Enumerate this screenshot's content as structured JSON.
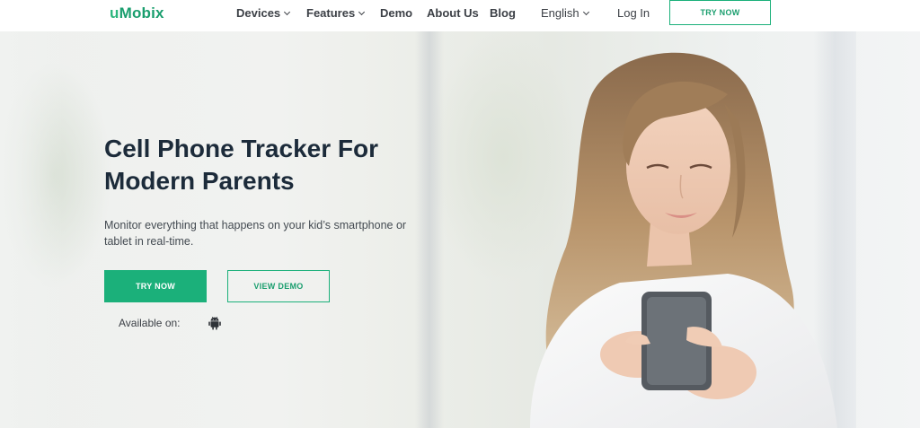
{
  "header": {
    "logo_prefix": "u",
    "logo_rest": "Mobix",
    "nav": {
      "devices": "Devices",
      "features": "Features",
      "demo": "Demo",
      "about": "About Us",
      "blog": "Blog",
      "language": "English",
      "login": "Log In"
    },
    "try_button": "TRY NOW"
  },
  "hero": {
    "title": "Cell Phone Tracker For Modern Parents",
    "subtitle": "Monitor everything that happens on your kid’s smartphone or tablet in real-time.",
    "try_button": "TRY NOW",
    "demo_button": "VIEW DEMO",
    "available_label": "Available on:",
    "platform_icon": "android-icon"
  },
  "colors": {
    "accent": "#1bb07a",
    "heading": "#1c2b3a"
  }
}
